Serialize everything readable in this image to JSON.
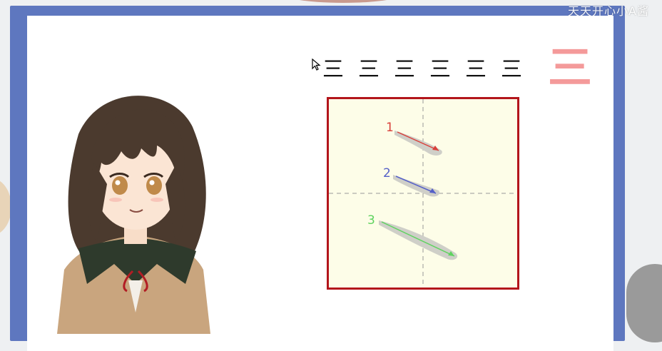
{
  "watermark": "天天开心小A酱",
  "glyph_row": [
    "三",
    "三",
    "三",
    "三",
    "三",
    "三"
  ],
  "main_character": "三",
  "strokes": [
    {
      "number": "1",
      "color": "#d9403a"
    },
    {
      "number": "2",
      "color": "#5560c8"
    },
    {
      "number": "3",
      "color": "#5fd35f"
    }
  ],
  "colors": {
    "frame": "#5e77bf",
    "grid_border": "#b3151b",
    "grid_fill": "#fdfde8",
    "main_character": "#f49a9a"
  }
}
